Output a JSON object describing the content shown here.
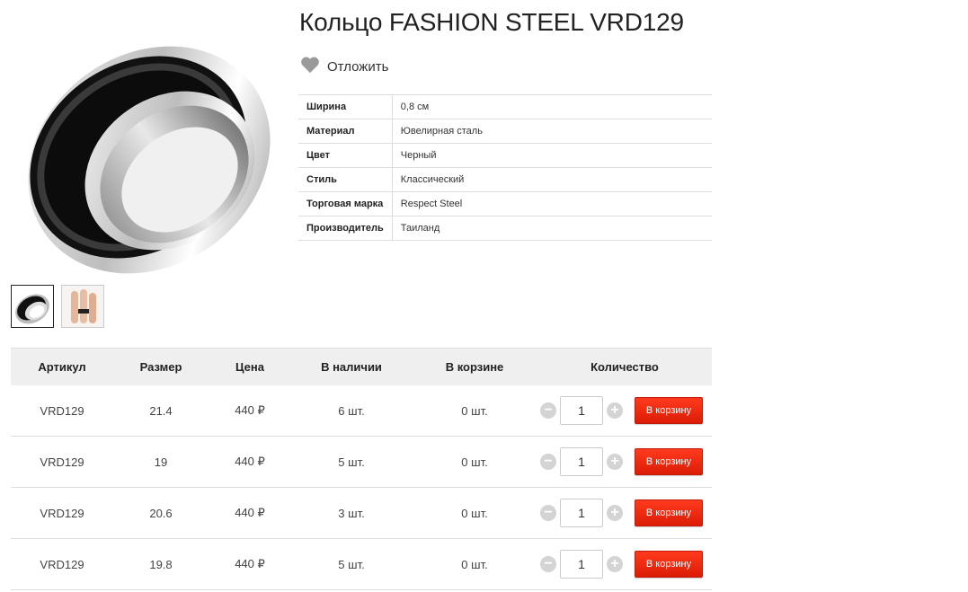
{
  "product": {
    "title": "Кольцо FASHION STEEL VRD129",
    "wishlist_label": "Отложить"
  },
  "properties": [
    {
      "name": "Ширина",
      "value": "0,8 см"
    },
    {
      "name": "Материал",
      "value": "Ювелирная сталь"
    },
    {
      "name": "Цвет",
      "value": "Черный"
    },
    {
      "name": "Стиль",
      "value": "Классический"
    },
    {
      "name": "Торговая марка",
      "value": "Respect Steel"
    },
    {
      "name": "Производитель",
      "value": "Таиланд"
    }
  ],
  "offers_table": {
    "headers": [
      "Артикул",
      "Размер",
      "Цена",
      "В наличии",
      "В корзине",
      "Количество"
    ],
    "rows": [
      {
        "sku": "VRD129",
        "size": "21.4",
        "price": "440 ₽",
        "stock": "6 шт.",
        "in_cart": "0 шт.",
        "qty": "1",
        "button": "В корзину"
      },
      {
        "sku": "VRD129",
        "size": "19",
        "price": "440 ₽",
        "stock": "5 шт.",
        "in_cart": "0 шт.",
        "qty": "1",
        "button": "В корзину"
      },
      {
        "sku": "VRD129",
        "size": "20.6",
        "price": "440 ₽",
        "stock": "3 шт.",
        "in_cart": "0 шт.",
        "qty": "1",
        "button": "В корзину"
      },
      {
        "sku": "VRD129",
        "size": "19.8",
        "price": "440 ₽",
        "stock": "5 шт.",
        "in_cart": "0 шт.",
        "qty": "1",
        "button": "В корзину"
      }
    ],
    "minus_symbol": "−",
    "plus_symbol": "+"
  },
  "colors": {
    "cart_button": "#e8260b",
    "heart_icon": "#9a9a9a",
    "header_bg": "#efefef"
  },
  "icons": [
    "heart-icon",
    "minus-icon",
    "plus-icon"
  ]
}
